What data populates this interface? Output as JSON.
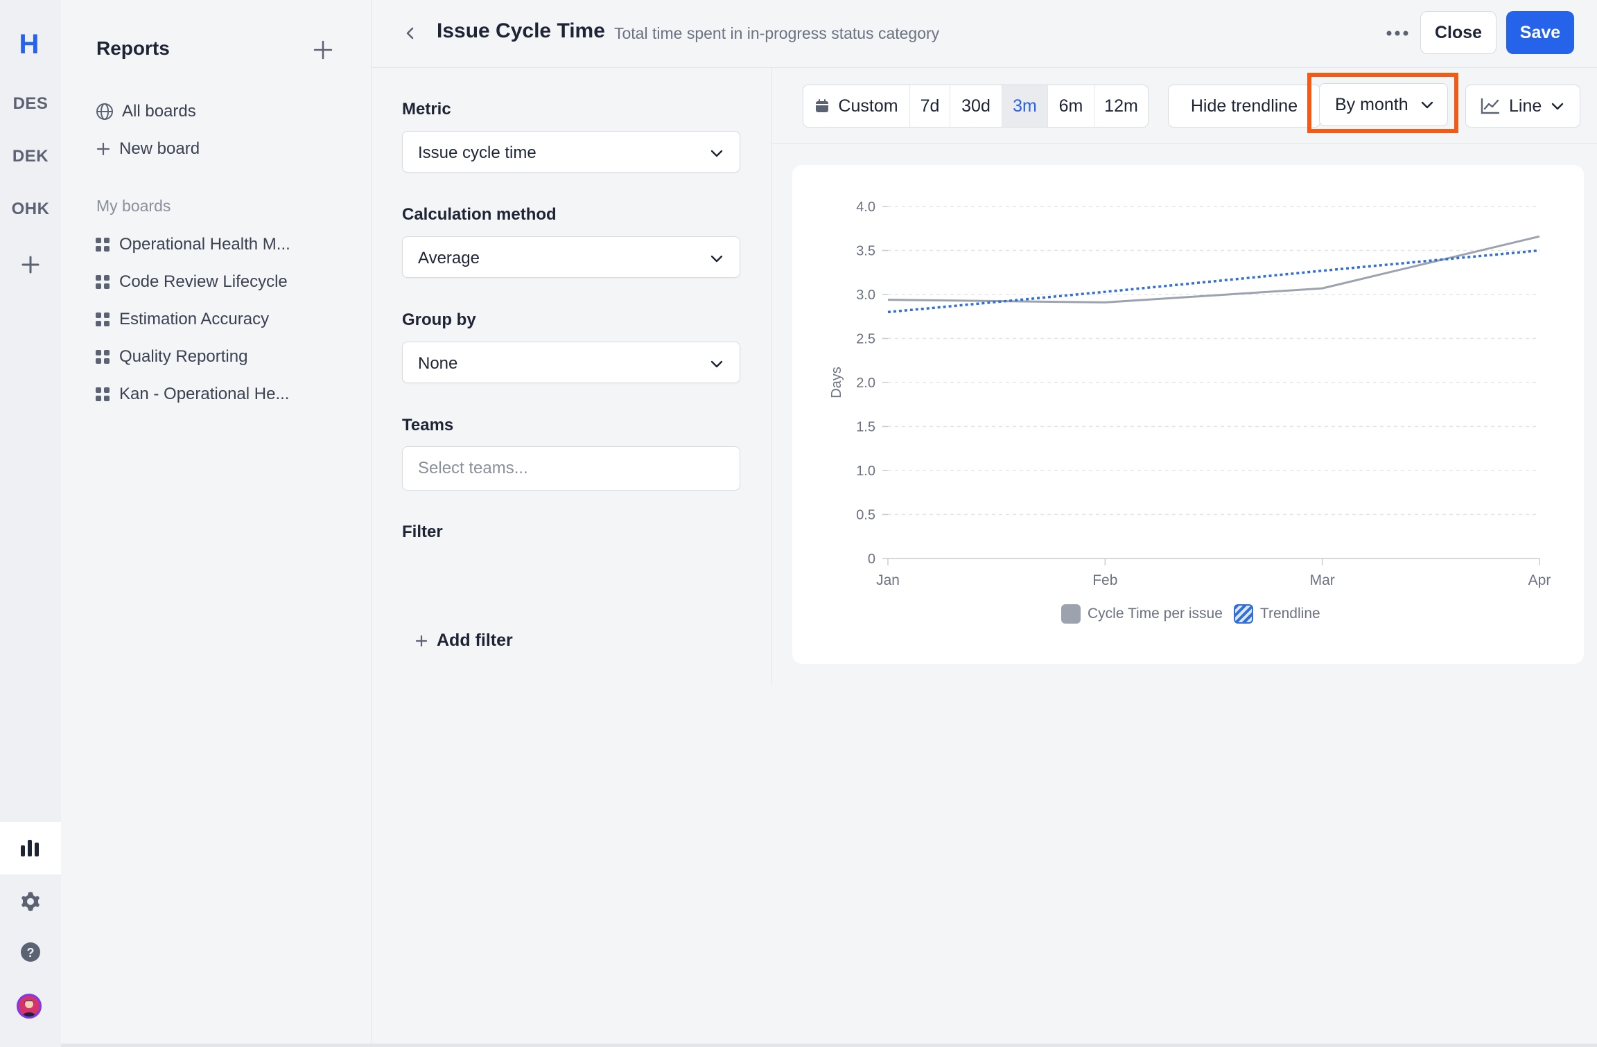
{
  "rail": {
    "logo": "H",
    "projects": [
      "DES",
      "DEK",
      "OHK"
    ]
  },
  "sidebar": {
    "title": "Reports",
    "links": [
      {
        "label": "All boards",
        "icon": "globe-icon"
      },
      {
        "label": "New board",
        "icon": "plus-icon"
      }
    ],
    "section_label": "My boards",
    "boards": [
      "Operational Health M...",
      "Code Review Lifecycle",
      "Estimation Accuracy",
      "Quality Reporting",
      "Kan - Operational He..."
    ]
  },
  "header": {
    "title": "Issue Cycle Time",
    "subtitle": "Total time spent in in-progress status category",
    "close_label": "Close",
    "save_label": "Save"
  },
  "config": {
    "metric": {
      "label": "Metric",
      "value": "Issue cycle time"
    },
    "calc": {
      "label": "Calculation method",
      "value": "Average"
    },
    "group": {
      "label": "Group by",
      "value": "None"
    },
    "teams": {
      "label": "Teams",
      "placeholder": "Select teams..."
    },
    "filter": {
      "label": "Filter",
      "add_label": "Add filter"
    }
  },
  "toolbar": {
    "ranges": [
      "Custom",
      "7d",
      "30d",
      "3m",
      "6m",
      "12m"
    ],
    "active_range": "3m",
    "hide_trendline": "Hide trendline",
    "granularity": "By month",
    "chart_type": "Line"
  },
  "colors": {
    "accent": "#2563eb",
    "series": "#9ca3af",
    "trend": "#2f6fd6",
    "highlight": "#f25a18"
  },
  "chart_data": {
    "type": "line",
    "x": [
      "Jan",
      "Feb",
      "Mar",
      "Apr"
    ],
    "ylabel": "Days",
    "ylim": [
      0,
      4.0
    ],
    "yticks": [
      "0",
      "0.5",
      "1.0",
      "1.5",
      "2.0",
      "2.5",
      "3.0",
      "3.5",
      "4.0"
    ],
    "grid": true,
    "legend_position": "bottom",
    "series": [
      {
        "name": "Cycle Time per issue",
        "values": [
          2.94,
          2.91,
          3.07,
          3.66
        ]
      },
      {
        "name": "Trendline",
        "values": [
          2.8,
          3.03,
          3.27,
          3.5
        ],
        "style": "dotted"
      }
    ]
  }
}
